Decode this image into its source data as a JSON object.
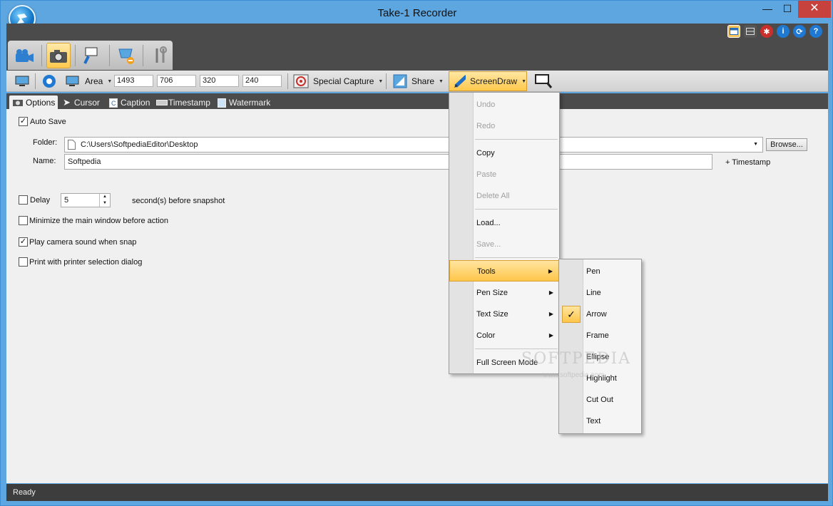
{
  "window": {
    "title": "Take-1 Recorder",
    "minimize": "—",
    "maximize": "☐",
    "close": "✕"
  },
  "top_icons": [
    "layout-icon",
    "grid-icon",
    "bug-icon",
    "info-icon",
    "logo-icon",
    "help-icon"
  ],
  "toolbar": {
    "area_label": "Area",
    "x": "1493",
    "y": "706",
    "width": "320",
    "height": "240",
    "special_capture_label": "Special Capture",
    "share_label": "Share",
    "screendraw_label": "ScreenDraw"
  },
  "subtabs": {
    "options": "Options",
    "cursor": "Cursor",
    "caption": "Caption",
    "timestamp": "Timestamp",
    "watermark": "Watermark"
  },
  "options": {
    "auto_save_label": "Auto Save",
    "auto_save_checked": true,
    "folder_label": "Folder:",
    "folder_value": "C:\\Users\\SoftpediaEditor\\Desktop",
    "browse_label": "Browse...",
    "name_label": "Name:",
    "name_value": "Softpedia",
    "timestamp_link": "+ Timestamp",
    "delay_label": "Delay",
    "delay_value": "5",
    "delay_suffix": "second(s) before snapshot",
    "minimize_label": "Minimize the main window before action",
    "camera_sound_label": "Play camera sound when snap",
    "print_label": "Print with printer selection dialog"
  },
  "screendraw_menu": {
    "undo": "Undo",
    "redo": "Redo",
    "copy": "Copy",
    "paste": "Paste",
    "delete_all": "Delete All",
    "load": "Load...",
    "save": "Save...",
    "tools": "Tools",
    "pen_size": "Pen Size",
    "text_size": "Text Size",
    "color": "Color",
    "full_screen": "Full Screen Mode"
  },
  "tools_menu": {
    "items": [
      "Pen",
      "Line",
      "Arrow",
      "Frame",
      "Ellipse",
      "Highlight",
      "Cut Out",
      "Text"
    ],
    "checked": "Arrow",
    "checkmark": "✓"
  },
  "status": {
    "text": "Ready"
  },
  "watermark": {
    "brand": "SOFTPEDIA",
    "url": "www.softpedia.com"
  }
}
